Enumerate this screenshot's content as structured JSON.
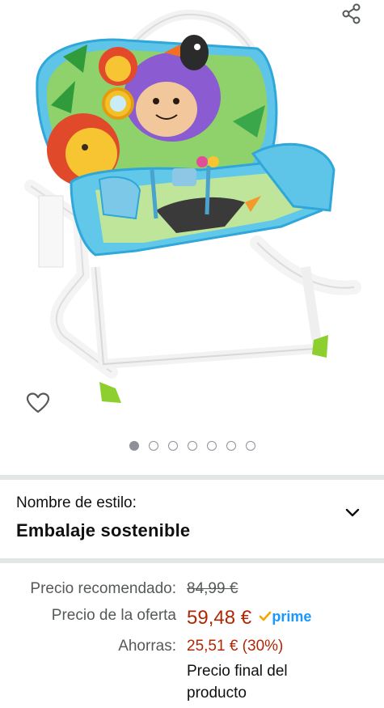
{
  "gallery": {
    "image_alt": "Mecedora infantil Fisher-Price con estampado de animales de la selva",
    "dots_total": 7,
    "active_dot": 0,
    "icons": {
      "share": "share-icon",
      "wishlist": "heart-icon"
    }
  },
  "style": {
    "label": "Nombre de estilo:",
    "value": "Embalaje sostenible",
    "toggle_icon": "chevron-down-icon"
  },
  "pricing": {
    "list_label": "Precio recomendado:",
    "list_price": "84,99 €",
    "deal_label": "Precio de la oferta",
    "deal_price": "59,48 €",
    "prime_badge": "prime",
    "savings_label": "Ahorras:",
    "savings_value": "25,51 € (30%)",
    "final_line1": "Precio final del",
    "final_line2": "producto"
  },
  "colors": {
    "deal_price": "#b12704",
    "prime": "#1a98ff",
    "prime_check": "#f7a600",
    "dot": "#8d9096",
    "divider": "#e3e6e6"
  }
}
